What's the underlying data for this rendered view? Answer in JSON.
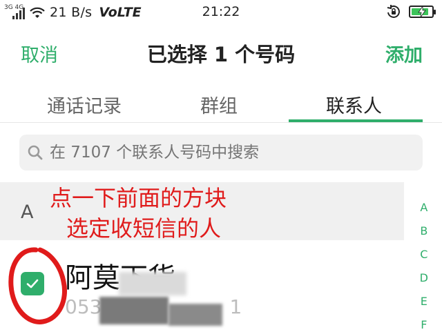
{
  "status_bar": {
    "network_label": "3G 4G",
    "speed": "21 B/s",
    "volte": "VoLTE",
    "time": "21:22"
  },
  "header": {
    "cancel_label": "取消",
    "title": "已选择 1 个号码",
    "add_label": "添加"
  },
  "tabs": [
    {
      "label": "通话记录"
    },
    {
      "label": "群组"
    },
    {
      "label": "联系人"
    }
  ],
  "active_tab": "联系人",
  "search": {
    "placeholder": "在 7107 个联系人号码中搜索"
  },
  "section": {
    "letter": "A"
  },
  "annotation": {
    "line1": "点一下前面的方块",
    "line2": "选定收短信的人"
  },
  "alphabet_index": [
    "A",
    "B",
    "C",
    "D",
    "E",
    "F"
  ],
  "contact": {
    "name": "阿莫下货",
    "number_visible": "053",
    "number_tail": "1",
    "checked": true
  },
  "colors": {
    "accent": "#2fae6b",
    "annotation_red": "#e01b1b",
    "battery_green": "#3cc45a"
  },
  "battery_level": 0.85
}
